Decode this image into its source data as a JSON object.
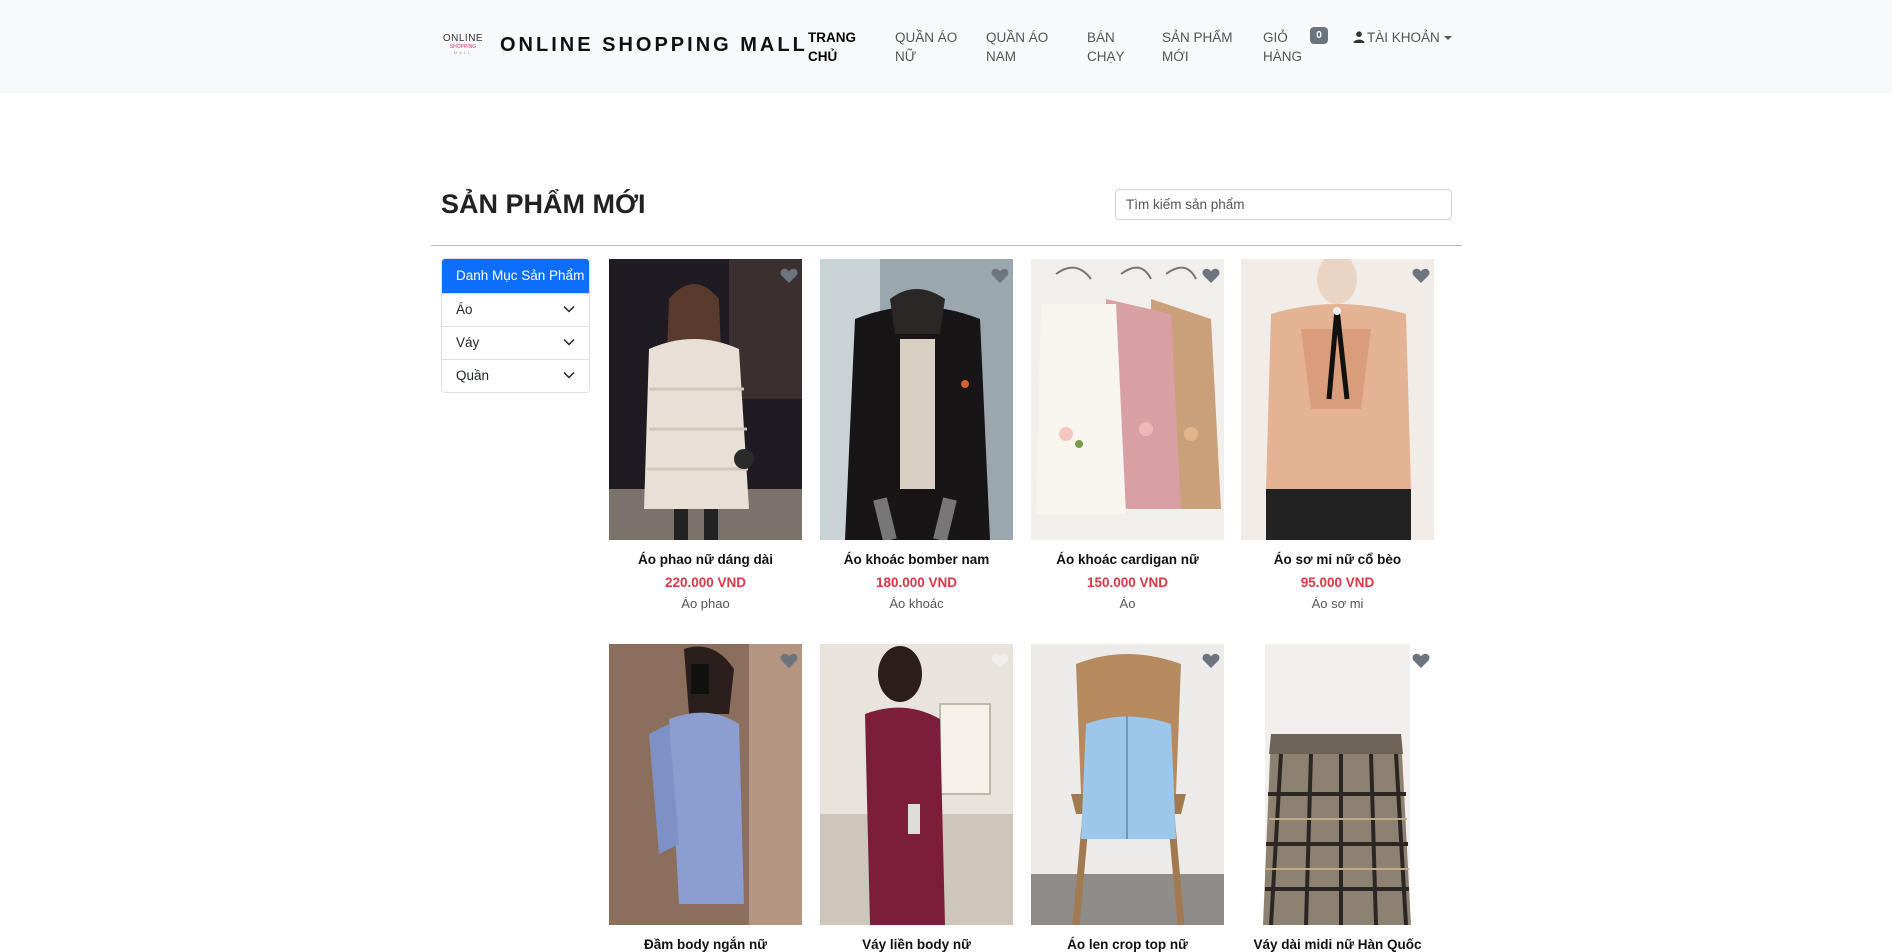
{
  "header": {
    "logo_line1": "ONLINE",
    "logo_line2": "SHOPPING",
    "logo_line3": "MALL",
    "brand": "ONLINE SHOPPING MALL",
    "nav": [
      {
        "line1": "TRANG",
        "line2": "CHỦ"
      },
      {
        "line1": "QUẦN ÁO",
        "line2": "NỮ"
      },
      {
        "line1": "QUẦN ÁO",
        "line2": "NAM"
      },
      {
        "line1": "BÁN",
        "line2": "CHẠY"
      },
      {
        "line1": "SẢN PHẨM",
        "line2": "MỚI"
      },
      {
        "line1": "GIỎ",
        "line2": "HÀNG"
      }
    ],
    "cart_count": "0",
    "account_label": "TÀI KHOẢN"
  },
  "page": {
    "title": "SẢN PHẨM MỚI",
    "search_placeholder": "Tìm kiếm sản phẩm"
  },
  "sidebar": {
    "header": "Danh Mục Sản Phẩm",
    "items": [
      "Áo",
      "Váy",
      "Quần"
    ]
  },
  "products": [
    {
      "name": "Áo phao nữ dáng dài",
      "price": "220.000 VND",
      "category": "Áo phao"
    },
    {
      "name": "Áo khoác bomber nam",
      "price": "180.000 VND",
      "category": "Áo khoác"
    },
    {
      "name": "Áo khoác cardigan nữ",
      "price": "150.000 VND",
      "category": "Áo"
    },
    {
      "name": "Áo sơ mi nữ cổ bèo",
      "price": "95.000 VND",
      "category": "Áo sơ mi"
    },
    {
      "name": "Đầm body ngắn nữ"
    },
    {
      "name": "Váy liền body nữ"
    },
    {
      "name": "Áo len crop top nữ"
    },
    {
      "name": "Váy dài midi nữ Hàn Quốc"
    }
  ],
  "colors": {
    "primary": "#0d6efd",
    "price": "#dc3545",
    "navbar_bg": "#f8f9fa",
    "badge": "#6c757d"
  }
}
